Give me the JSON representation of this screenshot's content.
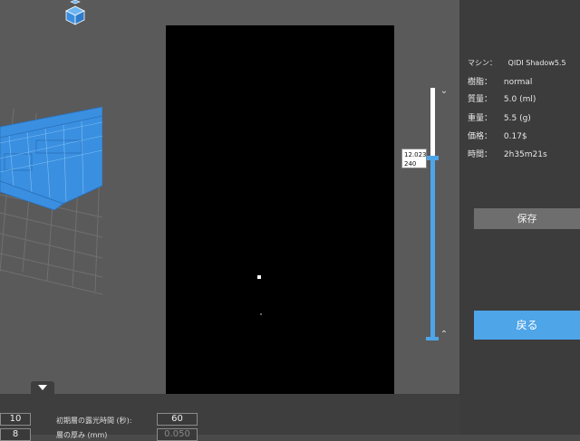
{
  "right_panel": {
    "machine_label": "マシン：",
    "machine_value": "QIDI Shadow5.5",
    "resin_label": "樹脂：",
    "resin_value": "normal",
    "volume_label": "質量：",
    "volume_value": "5.0  (ml)",
    "weight_label": "重量：",
    "weight_value": "5.5  (g)",
    "price_label": "価格：",
    "price_value": "0.17$",
    "time_label": "時間：",
    "time_value": "2h35m21s",
    "save_label": "保存",
    "back_label": "戻る"
  },
  "slider": {
    "tooltip_height": "12.023",
    "tooltip_layer": "240",
    "up_icon": "chevron-up-icon",
    "down_icon": "chevron-down-icon",
    "position_fraction": 0.72
  },
  "bottom_panel": {
    "left_value_1": "10",
    "left_value_2": "8",
    "initial_exposure_label": "初期層の露光時間 (秒):",
    "initial_exposure_value": "60",
    "layer_thickness_label": "層の厚み (mm)",
    "layer_thickness_value": "0.050"
  },
  "colors": {
    "accent": "#4ea5e8",
    "model": "#3a8fe0",
    "panel": "#3c3c3c",
    "background": "#5a5a5a"
  },
  "icons": {
    "view_cube": "view-cube-icon",
    "collapse": "triangle-down-icon"
  }
}
